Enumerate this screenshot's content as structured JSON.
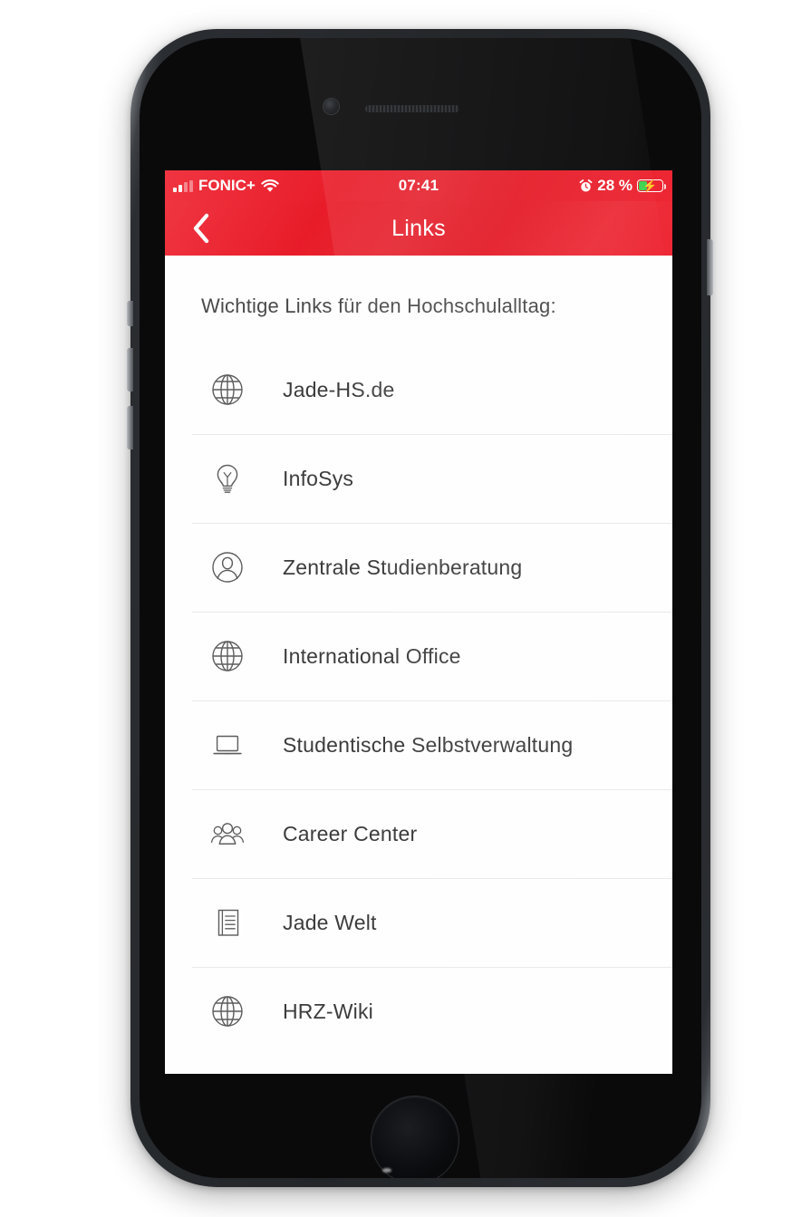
{
  "device": {
    "type": "smartphone",
    "hardware": {
      "camera": "front-camera",
      "speaker": "earpiece-speaker",
      "home_button": "home-button",
      "buttons": [
        "mute-switch",
        "volume-up",
        "volume-down",
        "power-button"
      ]
    }
  },
  "status_bar": {
    "carrier": "FONIC+",
    "signal_bars_filled": 2,
    "signal_bars_total": 4,
    "wifi_icon": "wifi-icon",
    "time": "07:41",
    "alarm_icon": "alarm-clock-icon",
    "battery_percent": "28 %",
    "battery_level": 28,
    "battery_charging": true,
    "charging_icon": "lightning-bolt-icon",
    "background_color": "#E81D2A",
    "text_color": "#FFFFFF"
  },
  "nav_bar": {
    "back_icon": "chevron-left-icon",
    "title": "Links",
    "background_color": "#E81D2A",
    "title_color": "#FFFFFF"
  },
  "content": {
    "intro_text": "Wichtige Links für den Hochschulalltag:",
    "background_color": "#FEFEFE",
    "text_color": "#3C3C3C",
    "divider_color": "#E9E9E9",
    "links": [
      {
        "label": "Jade-HS.de",
        "icon": "globe-icon"
      },
      {
        "label": "InfoSys",
        "icon": "lightbulb-icon"
      },
      {
        "label": "Zentrale Studienberatung",
        "icon": "person-circle-icon"
      },
      {
        "label": "International Office",
        "icon": "globe-icon"
      },
      {
        "label": "Studentische Selbstverwaltung",
        "icon": "laptop-icon"
      },
      {
        "label": "Career Center",
        "icon": "people-group-icon"
      },
      {
        "label": "Jade Welt",
        "icon": "document-lines-icon"
      },
      {
        "label": "HRZ-Wiki",
        "icon": "globe-icon"
      }
    ]
  }
}
